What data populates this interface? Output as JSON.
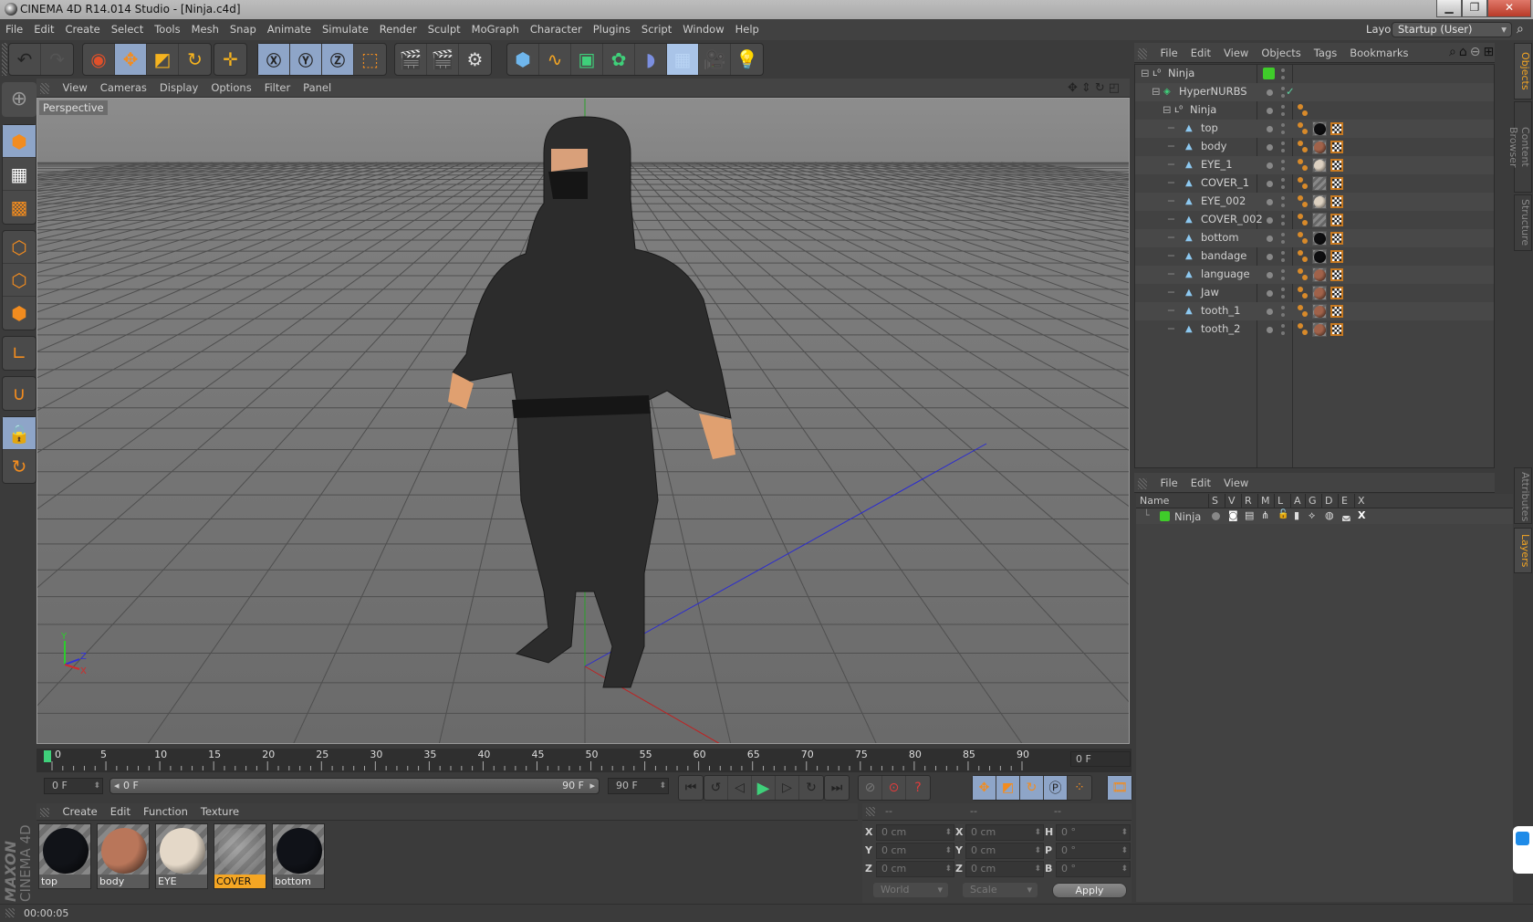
{
  "window": {
    "title": "CINEMA 4D R14.014 Studio - [Ninja.c4d]",
    "controls": [
      "minimize",
      "restore",
      "close"
    ]
  },
  "menubar": [
    "File",
    "Edit",
    "Create",
    "Select",
    "Tools",
    "Mesh",
    "Snap",
    "Animate",
    "Simulate",
    "Render",
    "Sculpt",
    "MoGraph",
    "Character",
    "Plugins",
    "Script",
    "Window",
    "Help"
  ],
  "layout": {
    "label": "Layout:",
    "value": "Startup (User)"
  },
  "toolbar": {
    "groups": [
      [
        "undo-icon",
        "redo-icon"
      ],
      [
        "live-selection-icon",
        "move-icon",
        "scale-icon",
        "rotate-icon"
      ],
      [
        "recent-tools-icon"
      ],
      [
        "x-axis-icon",
        "y-axis-icon",
        "z-axis-icon",
        "coordinate-system-icon"
      ],
      [
        "render-view-icon",
        "render-picture-viewer-icon",
        "render-settings-icon"
      ],
      [
        "cube-primitive-icon",
        "spline-pen-icon",
        "subdivision-surface-icon",
        "array-icon",
        "deformer-icon",
        "floor-icon",
        "camera-icon",
        "light-icon"
      ]
    ]
  },
  "left_tools": [
    "model-mode-icon",
    "texture-mode-icon",
    "workplane-mode-icon",
    "points-mode-icon",
    "edges-mode-icon",
    "polygons-mode-icon",
    "axis-mode-icon",
    "snap-magnet-icon",
    "workplane-lock-icon",
    "workplane-rotate-icon"
  ],
  "viewport": {
    "menu": [
      "View",
      "Cameras",
      "Display",
      "Options",
      "Filter",
      "Panel"
    ],
    "label": "Perspective",
    "axis_labels": {
      "x": "X",
      "y": "Y",
      "z": "Z"
    }
  },
  "timeline": {
    "ticks": [
      "0",
      "5",
      "10",
      "15",
      "20",
      "25",
      "30",
      "35",
      "40",
      "45",
      "50",
      "55",
      "60",
      "65",
      "70",
      "75",
      "80",
      "85",
      "90"
    ],
    "current_frame": "0 F",
    "start_field": "0 F",
    "range_start": "0 F",
    "range_end": "90 F",
    "end_field": "90 F"
  },
  "materials": {
    "menu": [
      "Create",
      "Edit",
      "Function",
      "Texture"
    ],
    "items": [
      {
        "name": "top",
        "selected": false,
        "color": "#111318"
      },
      {
        "name": "body",
        "selected": false,
        "color": "#b9765a"
      },
      {
        "name": "EYE",
        "selected": false,
        "color": "#e4d8c8"
      },
      {
        "name": "COVER",
        "selected": true,
        "color": "#8c8c8c"
      },
      {
        "name": "bottom",
        "selected": false,
        "color": "#101218"
      }
    ]
  },
  "brand": {
    "line1": "MAXON",
    "line2": "CINEMA 4D"
  },
  "coordinates": {
    "headers": [
      "--",
      "--",
      "--"
    ],
    "rows": [
      {
        "l1": "X",
        "v1": "0 cm",
        "l2": "X",
        "v2": "0 cm",
        "l3": "H",
        "v3": "0 °"
      },
      {
        "l1": "Y",
        "v1": "0 cm",
        "l2": "Y",
        "v2": "0 cm",
        "l3": "P",
        "v3": "0 °"
      },
      {
        "l1": "Z",
        "v1": "0 cm",
        "l2": "Z",
        "v2": "0 cm",
        "l3": "B",
        "v3": "0 °"
      }
    ],
    "space": "World",
    "mode": "Scale",
    "apply": "Apply"
  },
  "status": {
    "time": "00:00:05"
  },
  "objects": {
    "menu": [
      "File",
      "Edit",
      "View",
      "Objects",
      "Tags",
      "Bookmarks"
    ],
    "tree": [
      {
        "name": "Ninja",
        "type": "null",
        "depth": 0,
        "layer_color": "#3fcc2a",
        "tags": []
      },
      {
        "name": "HyperNURBS",
        "type": "hypernurbs",
        "depth": 1,
        "enabled": true,
        "tags": []
      },
      {
        "name": "Ninja",
        "type": "null",
        "depth": 2,
        "tags": [
          "phong"
        ]
      },
      {
        "name": "top",
        "type": "polygon",
        "depth": 3,
        "tags": [
          "phong",
          "material",
          "uvw"
        ],
        "mat": "#0e0e10"
      },
      {
        "name": "body",
        "type": "polygon",
        "depth": 3,
        "tags": [
          "phong",
          "material",
          "uvw"
        ],
        "mat": "#a0624a"
      },
      {
        "name": "EYE_1",
        "type": "polygon",
        "depth": 3,
        "tags": [
          "phong",
          "material",
          "uvw"
        ],
        "mat": "#dcd0c0"
      },
      {
        "name": "COVER_1",
        "type": "polygon",
        "depth": 3,
        "tags": [
          "phong",
          "material",
          "uvw"
        ],
        "mat": "transparent"
      },
      {
        "name": "EYE_002",
        "type": "polygon",
        "depth": 3,
        "tags": [
          "phong",
          "material",
          "uvw"
        ],
        "mat": "#dcd0c0"
      },
      {
        "name": "COVER_002",
        "type": "polygon",
        "depth": 3,
        "tags": [
          "phong",
          "material",
          "uvw"
        ],
        "mat": "transparent"
      },
      {
        "name": "bottom",
        "type": "polygon",
        "depth": 3,
        "tags": [
          "phong",
          "material",
          "uvw"
        ],
        "mat": "#0e0e10"
      },
      {
        "name": "bandage",
        "type": "polygon",
        "depth": 3,
        "tags": [
          "phong",
          "material",
          "uvw"
        ],
        "mat": "#0e0e10"
      },
      {
        "name": "language",
        "type": "polygon",
        "depth": 3,
        "tags": [
          "phong",
          "material",
          "uvw"
        ],
        "mat": "#a0624a"
      },
      {
        "name": "Jaw",
        "type": "polygon",
        "depth": 3,
        "tags": [
          "phong",
          "material",
          "uvw"
        ],
        "mat": "#a0624a"
      },
      {
        "name": "tooth_1",
        "type": "polygon",
        "depth": 3,
        "tags": [
          "phong",
          "material",
          "uvw"
        ],
        "mat": "#a0624a"
      },
      {
        "name": "tooth_2",
        "type": "polygon",
        "depth": 3,
        "tags": [
          "phong",
          "material",
          "uvw"
        ],
        "mat": "#a0624a"
      }
    ]
  },
  "side_tabs_top": [
    {
      "label": "Objects",
      "active": true
    },
    {
      "label": "Content Browser",
      "active": false
    },
    {
      "label": "Structure",
      "active": false
    }
  ],
  "side_tabs_bottom": [
    {
      "label": "Attributes",
      "active": false
    },
    {
      "label": "Layers",
      "active": true
    }
  ],
  "layers": {
    "menu": [
      "File",
      "Edit",
      "View"
    ],
    "columns": [
      "Name",
      "S",
      "V",
      "R",
      "M",
      "L",
      "A",
      "G",
      "D",
      "E",
      "X"
    ],
    "rows": [
      {
        "name": "Ninja",
        "color": "#3fcc2a"
      }
    ]
  },
  "colors": {
    "accent": "#f5a623",
    "selected_tool": "#8ea5c8",
    "panel_bg": "#424242"
  }
}
